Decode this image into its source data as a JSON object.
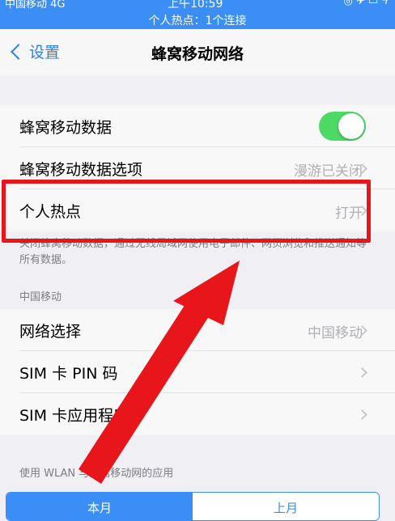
{
  "status_bar": {
    "carrier": "中国移动  4G",
    "time": "上午10:59",
    "right_icons": "◎ ✈ ▭ ϟ",
    "hotspot_banner": "个人热点：1个连接"
  },
  "navbar": {
    "back_label": "设置",
    "title": "蜂窝移动网络"
  },
  "rows_main": [
    {
      "label": "蜂窝移动数据",
      "toggle_on": true
    },
    {
      "label": "蜂窝移动数据选项",
      "value": "漫游已关闭"
    },
    {
      "label": "个人热点",
      "value": "打开"
    }
  ],
  "footnote": "关闭蜂窝移动数据，通过无线局域网使用电子邮件、网页浏览和推送通知等所有数据。",
  "section_carrier": {
    "header": "中国移动",
    "rows": [
      {
        "label": "网络选择",
        "value": "中国移动"
      },
      {
        "label": "SIM 卡 PIN 码"
      },
      {
        "label": "SIM 卡应用程序"
      }
    ]
  },
  "section_usage": {
    "header": "使用 WLAN 与蜂窝移动网的应用"
  },
  "segments": [
    "本月",
    "上月"
  ],
  "colors": {
    "accent": "#3a8ef5",
    "toggle_on": "#4cd964",
    "annotation_red": "#e8151b"
  }
}
